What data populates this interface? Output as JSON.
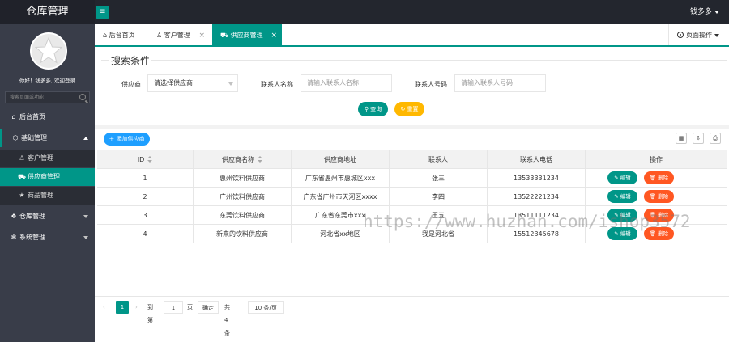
{
  "header": {
    "logo": "仓库管理",
    "toggle_icon": "≡",
    "user_name": "钱多多"
  },
  "sidebar": {
    "welcome": "你好！钱多多, 欢迎登录",
    "search_placeholder": "搜索页面或功能",
    "items": [
      {
        "label": "后台首页",
        "icon": "home-icon"
      },
      {
        "label": "基础管理",
        "icon": "cube-icon"
      },
      {
        "label": "客户管理",
        "icon": "user-icon"
      },
      {
        "label": "供应商管理",
        "icon": "cart-icon"
      },
      {
        "label": "商品管理",
        "icon": "star-icon"
      },
      {
        "label": "仓库管理",
        "icon": "diamond-icon"
      },
      {
        "label": "系统管理",
        "icon": "gear-icon"
      }
    ]
  },
  "tabs": [
    {
      "label": "后台首页"
    },
    {
      "label": "客户管理",
      "close": "×"
    },
    {
      "label": "供应商管理",
      "close": "×"
    }
  ],
  "page_ops": "页面操作",
  "search": {
    "title": "搜索条件",
    "provider_label": "供应商",
    "provider_value": "请选择供应商",
    "contact_label": "联系人名称",
    "contact_placeholder": "请输入联系人名称",
    "phone_label": "联系人号码",
    "phone_placeholder": "请输入联系人号码",
    "query_btn": "查询",
    "reset_btn": "重置"
  },
  "add_btn": "添加供应商",
  "table": {
    "headers": [
      "ID",
      "供应商名称",
      "供应商地址",
      "联系人",
      "联系人电话",
      "操作"
    ],
    "edit_label": "编辑",
    "delete_label": "删除",
    "rows": [
      {
        "id": "1",
        "name": "惠州饮料供应商",
        "address": "广东省惠州市惠城区xxx",
        "contact": "张三",
        "phone": "13533331234"
      },
      {
        "id": "2",
        "name": "广州饮料供应商",
        "address": "广东省广州市天河区xxxx",
        "contact": "李四",
        "phone": "13522221234"
      },
      {
        "id": "3",
        "name": "东莞饮料供应商",
        "address": "广东省东莞市xxx",
        "contact": "王五",
        "phone": "13511111234"
      },
      {
        "id": "4",
        "name": "新来的饮料供应商",
        "address": "河北省xx地区",
        "contact": "我是河北省",
        "phone": "15512345678"
      }
    ]
  },
  "pager": {
    "prev": "‹",
    "current": "1",
    "next": "›",
    "goto_label": "到第",
    "goto_value": "1",
    "page_unit": "页",
    "confirm": "确定",
    "total": "共 4 条",
    "page_size": "10 条/页"
  },
  "watermark": "https://www.huzhan.com/ishop3572"
}
